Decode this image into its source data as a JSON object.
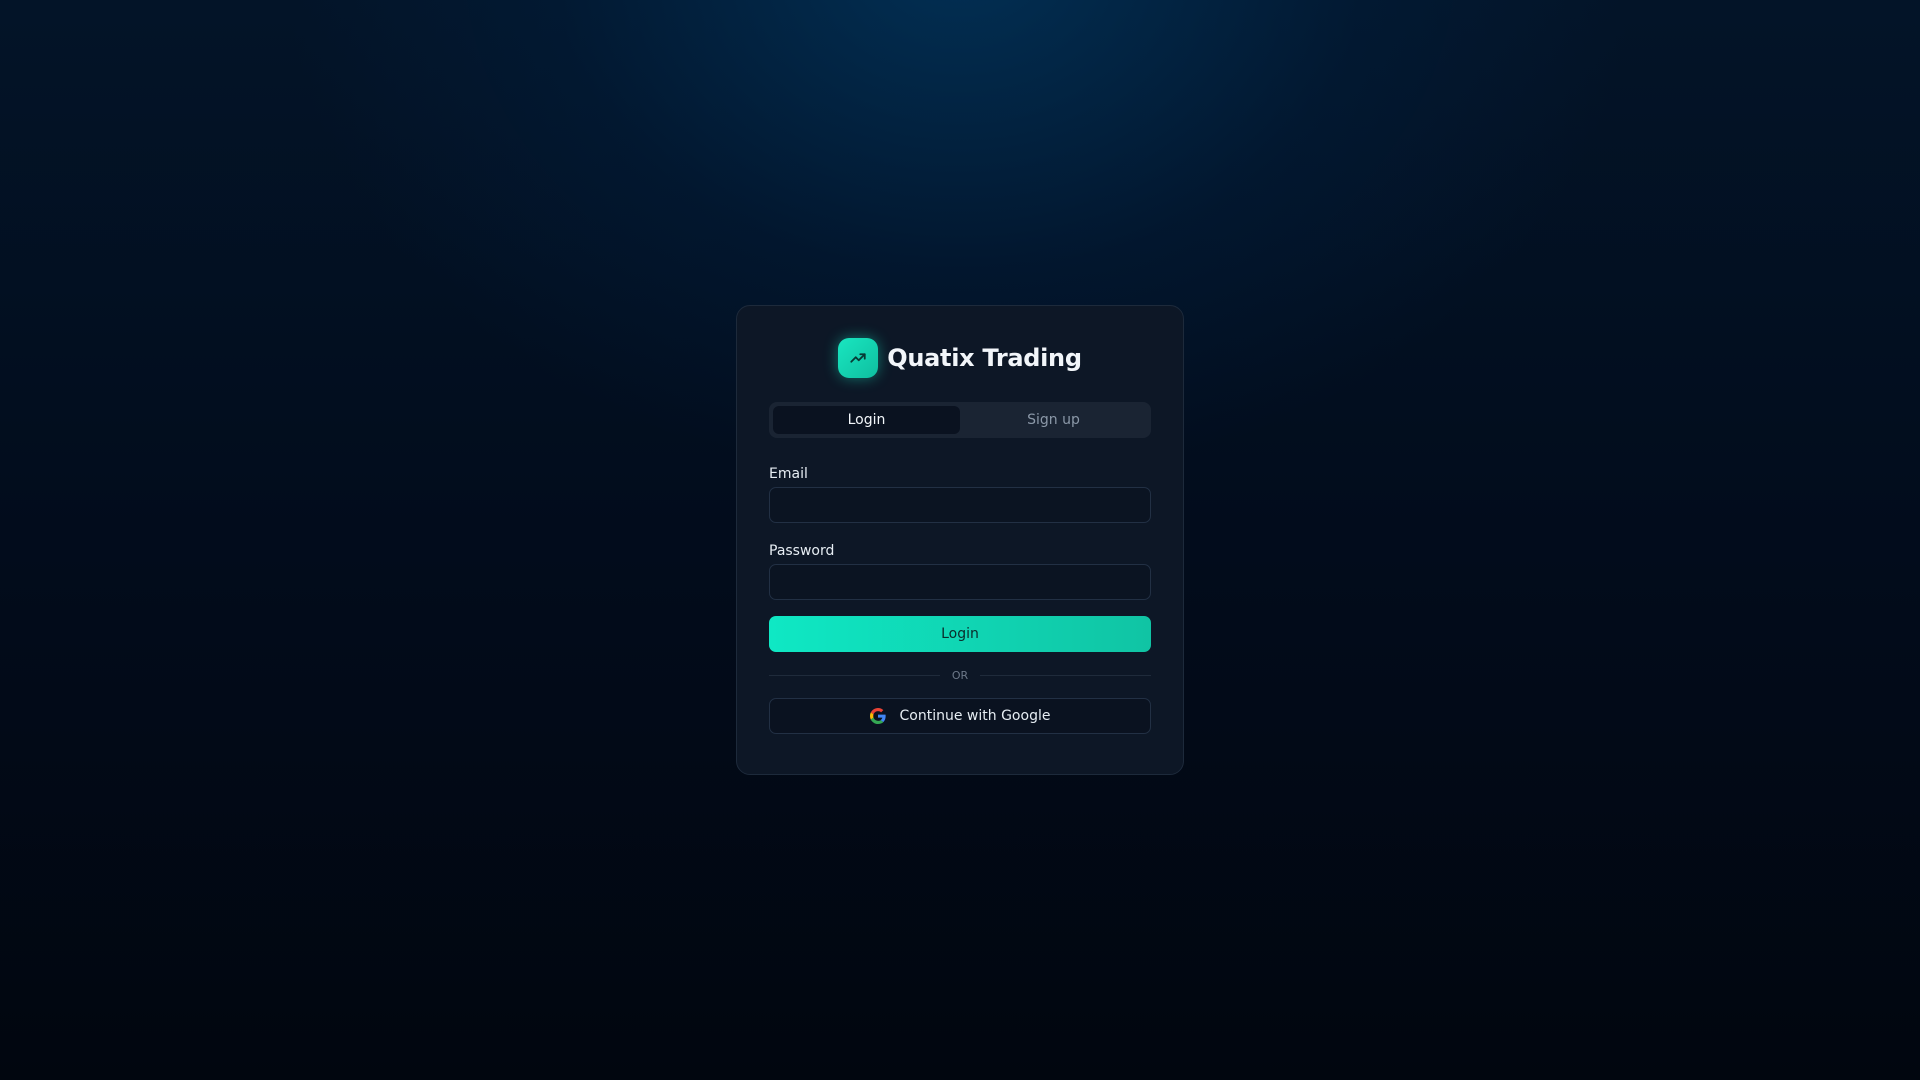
{
  "brand": {
    "name": "Quatix Trading",
    "icon": "trending-up-icon",
    "accent_color": "#19e6c0"
  },
  "tabs": [
    {
      "label": "Login",
      "active": true
    },
    {
      "label": "Sign up",
      "active": false
    }
  ],
  "form": {
    "email": {
      "label": "Email",
      "value": "",
      "placeholder": ""
    },
    "password": {
      "label": "Password",
      "value": "",
      "placeholder": ""
    },
    "submit_label": "Login"
  },
  "divider": {
    "text": "OR"
  },
  "google": {
    "label": "Continue with Google",
    "icon": "google-icon"
  }
}
